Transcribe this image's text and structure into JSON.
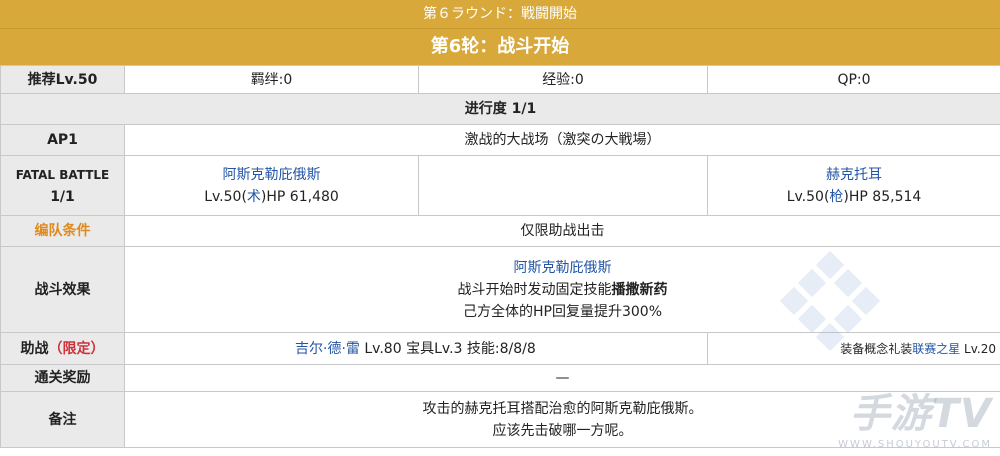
{
  "banner": {
    "jp_title": "第６ラウンド：戦闘開始",
    "cn_title": "第6轮：战斗开始"
  },
  "summary": {
    "recommend": "推荐Lv.50",
    "bond": "羁绊:0",
    "exp": "经验:0",
    "qp": "QP:0"
  },
  "progress": "进行度 1/1",
  "ap": {
    "label": "AP1",
    "stage": "激战的大战场（激突の大戦場）"
  },
  "fatal": {
    "label_line1": "FATAL BATTLE",
    "label_line2": "1/1",
    "enemy1_name": "阿斯克勒庇俄斯",
    "enemy1_lv_prefix": "Lv.50(",
    "enemy1_class": "术",
    "enemy1_lv_suffix": ")HP 61,480",
    "enemy2_name": "赫克托耳",
    "enemy2_lv_prefix": "Lv.50(",
    "enemy2_class": "枪",
    "enemy2_lv_suffix": ")HP 85,514"
  },
  "formation": {
    "label": "编队条件",
    "value": "仅限助战出击"
  },
  "effect": {
    "label": "战斗效果",
    "name": "阿斯克勒庇俄斯",
    "line2_prefix": "战斗开始时发动固定技能",
    "line2_skill": "播撒新药",
    "line3": "己方全体的HP回复量提升300%"
  },
  "support": {
    "label": "助战",
    "limited": "（限定）",
    "servant": "吉尔·德·雷",
    "detail": " Lv.80 宝具Lv.3 技能:8/8/8",
    "ce_prefix": "装备概念礼装",
    "ce_name": "联赛之星",
    "ce_lv": " Lv.20"
  },
  "reward": {
    "label": "通关奖励",
    "value": "—"
  },
  "note": {
    "label": "备注",
    "line1": "攻击的赫克托耳搭配治愈的阿斯克勒庇俄斯。",
    "line2": "应该先击破哪一方呢。"
  },
  "watermark": {
    "brand": "手游TV",
    "url": "WWW.SHOUYOUTV.COM"
  }
}
